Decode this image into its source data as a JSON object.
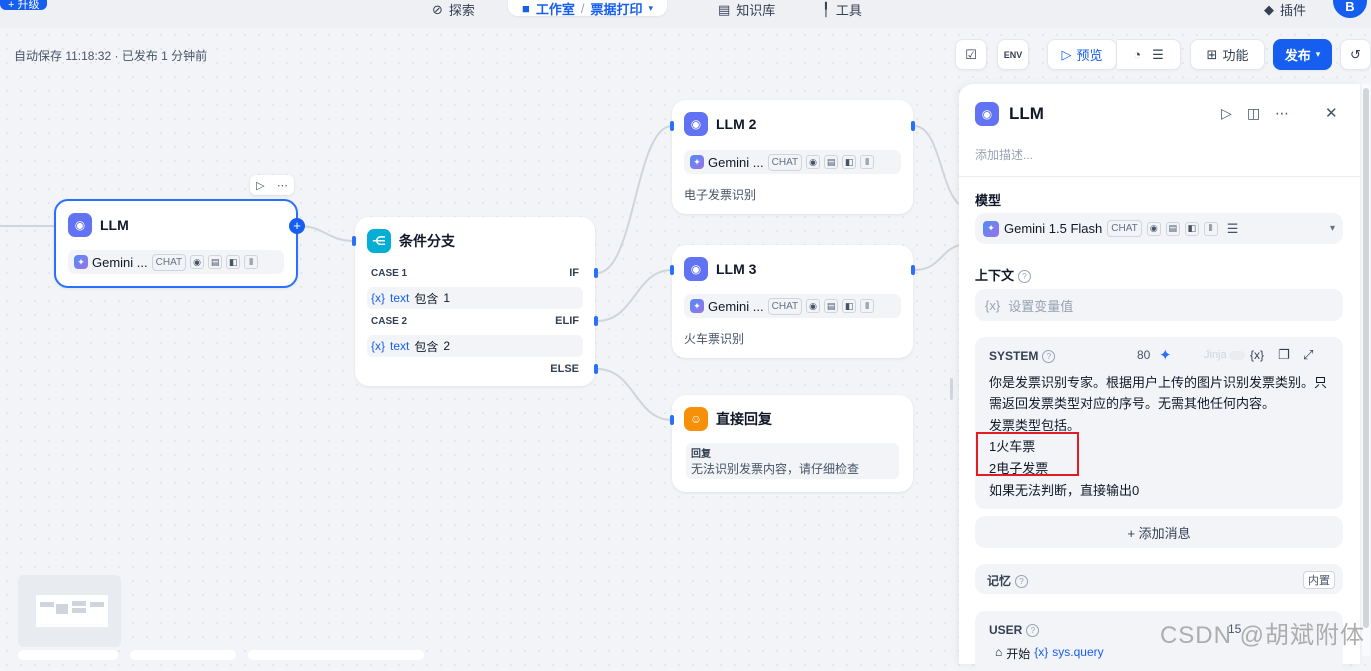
{
  "topbar": {
    "chip_label": "+ 升级",
    "explore_label": "探索",
    "studio_label": "工作室",
    "app_name": "票据打印",
    "knowledge_label": "知识库",
    "tools_label": "工具",
    "plugins_label": "插件",
    "avatar_initial": "B"
  },
  "canvas": {
    "autosave": "自动保存 11:18:32 · 已发布 1 分钟前"
  },
  "toolbar": {
    "env_label": "ENV",
    "preview_label": "预览",
    "features_label": "功能",
    "publish_label": "发布"
  },
  "nodes": {
    "llm1": {
      "title": "LLM",
      "model": "Gemini ...",
      "chip": "CHAT"
    },
    "branch": {
      "title": "条件分支",
      "cases": [
        {
          "label": "CASE 1",
          "keyword": "IF",
          "var": "text",
          "operator": "包含",
          "value": "1"
        },
        {
          "label": "CASE 2",
          "keyword": "ELIF",
          "var": "text",
          "operator": "包含",
          "value": "2"
        }
      ],
      "else_label": "ELSE"
    },
    "llm2": {
      "title": "LLM 2",
      "model": "Gemini ...",
      "chip": "CHAT",
      "desc": "电子发票识别"
    },
    "llm3": {
      "title": "LLM 3",
      "model": "Gemini ...",
      "chip": "CHAT",
      "desc": "火车票识别"
    },
    "answer": {
      "title": "直接回复",
      "reply_label": "回复",
      "reply_text": "无法识别发票内容，请仔细检查"
    }
  },
  "panel": {
    "title": "LLM",
    "desc_placeholder": "添加描述...",
    "model_label": "模型",
    "model_name": "Gemini 1.5 Flash",
    "model_chip": "CHAT",
    "context_label": "上下文",
    "context_placeholder": "设置变量值",
    "system_label": "SYSTEM",
    "token_count": "80",
    "jinja_label": "Jinja",
    "system_lines": [
      "你是发票识别专家。根据用户上传的图片识别发票类别。只",
      "需返回发票类型对应的序号。无需其他任何内容。",
      "发票类型包括。",
      "1火车票",
      "2电子发票",
      "如果无法判断，直接输出0"
    ],
    "add_message_label": "+ 添加消息",
    "memory_label": "记忆",
    "memory_badge": "内置",
    "user_label": "USER",
    "user_token": "15",
    "user_start": "开始",
    "user_var": "sys.query"
  },
  "watermark": "CSDN @胡斌附体",
  "colors": {
    "accent": "#155eef",
    "llm_icon": "#6172f3",
    "branch_icon": "#06aed4",
    "answer_icon": "#f79009",
    "highlight": "#e31b23"
  }
}
